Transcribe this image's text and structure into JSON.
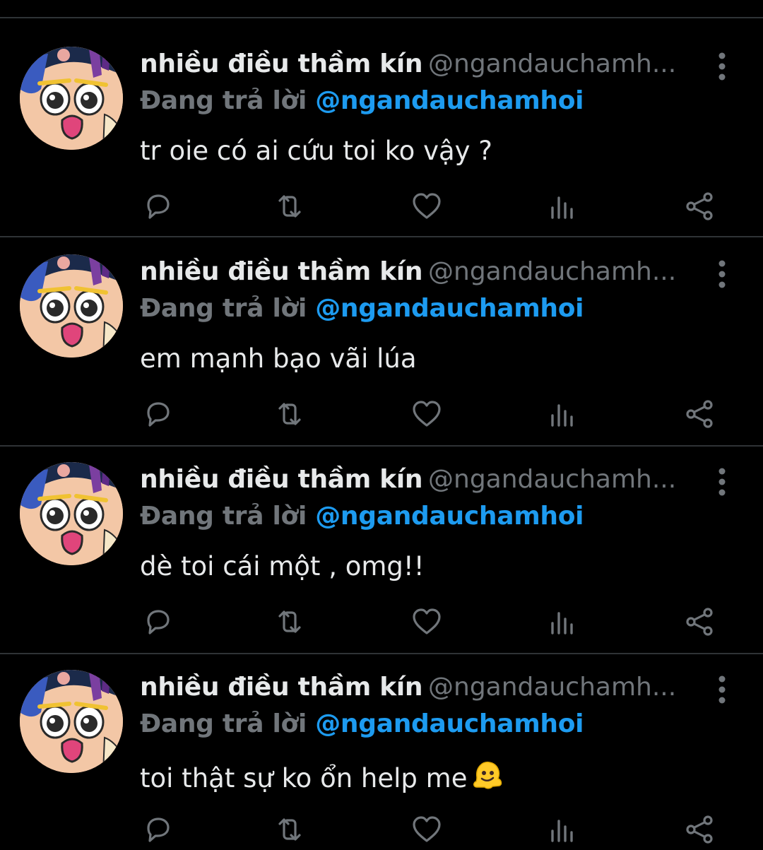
{
  "colors": {
    "background": "#000000",
    "divider": "#2f3336",
    "primary_text": "#e7e9ea",
    "secondary_text": "#71767b",
    "mention": "#1d9bf0"
  },
  "icons": [
    "avatar",
    "more-vertical-icon",
    "reply-icon",
    "retweet-icon",
    "like-icon",
    "views-icon",
    "share-icon",
    "melting-face-emoji"
  ],
  "tweets": [
    {
      "display_name": "nhiều điều thầm kín",
      "handle": "@ngandauchamh...",
      "replying_label": "Đang trả lời",
      "replying_to": "@ngandauchamhoi",
      "text": "tr oie có ai cứu toi ko vậy ?"
    },
    {
      "display_name": "nhiều điều thầm kín",
      "handle": "@ngandauchamh...",
      "replying_label": "Đang trả lời",
      "replying_to": "@ngandauchamhoi",
      "text": "em mạnh bạo vãi lúa"
    },
    {
      "display_name": "nhiều điều thầm kín",
      "handle": "@ngandauchamh...",
      "replying_label": "Đang trả lời",
      "replying_to": "@ngandauchamhoi",
      "text": "dè toi cái một , omg!!"
    },
    {
      "display_name": "nhiều điều thầm kín",
      "handle": "@ngandauchamh...",
      "replying_label": "Đang trả lời",
      "replying_to": "@ngandauchamhoi",
      "text": "toi thật sự ko ổn help me"
    }
  ]
}
